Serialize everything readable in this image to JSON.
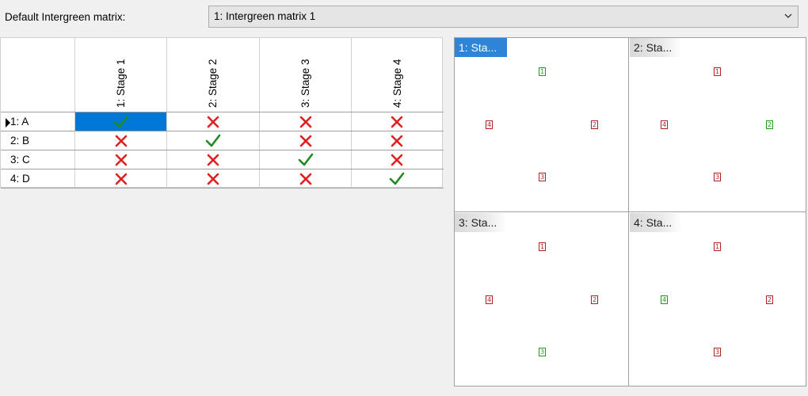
{
  "header": {
    "label": "Default Intergreen matrix:",
    "selected_value": "1: Intergreen matrix 1"
  },
  "matrix": {
    "columns": [
      "1: Stage 1",
      "2: Stage 2",
      "3: Stage 3",
      "4: Stage 4"
    ],
    "rows": [
      {
        "label": "1: A",
        "values": [
          "check",
          "cross",
          "cross",
          "cross"
        ]
      },
      {
        "label": "2: B",
        "values": [
          "cross",
          "check",
          "cross",
          "cross"
        ]
      },
      {
        "label": "3: C",
        "values": [
          "cross",
          "cross",
          "check",
          "cross"
        ]
      },
      {
        "label": "4: D",
        "values": [
          "cross",
          "cross",
          "cross",
          "check"
        ]
      }
    ],
    "selected_cell": {
      "row": 0,
      "col": 0
    },
    "current_row": 0
  },
  "stages": [
    {
      "tab": "1: Sta...",
      "active": true,
      "signals": {
        "1": "green",
        "2": "red",
        "3": "red",
        "4": "red"
      }
    },
    {
      "tab": "2: Sta...",
      "active": false,
      "signals": {
        "1": "red",
        "2": "green",
        "3": "red",
        "4": "red"
      }
    },
    {
      "tab": "3: Sta...",
      "active": false,
      "signals": {
        "1": "red",
        "2": "red",
        "3": "green",
        "4": "red"
      }
    },
    {
      "tab": "4: Sta...",
      "active": false,
      "signals": {
        "1": "red",
        "2": "red",
        "3": "red",
        "4": "green"
      }
    }
  ],
  "colors": {
    "check": "#1f8a1f",
    "cross": "#e02020",
    "selection": "#0078d7"
  },
  "icons": {
    "check": "checkmark-icon",
    "cross": "cross-icon",
    "dropdown": "chevron-down-icon"
  }
}
